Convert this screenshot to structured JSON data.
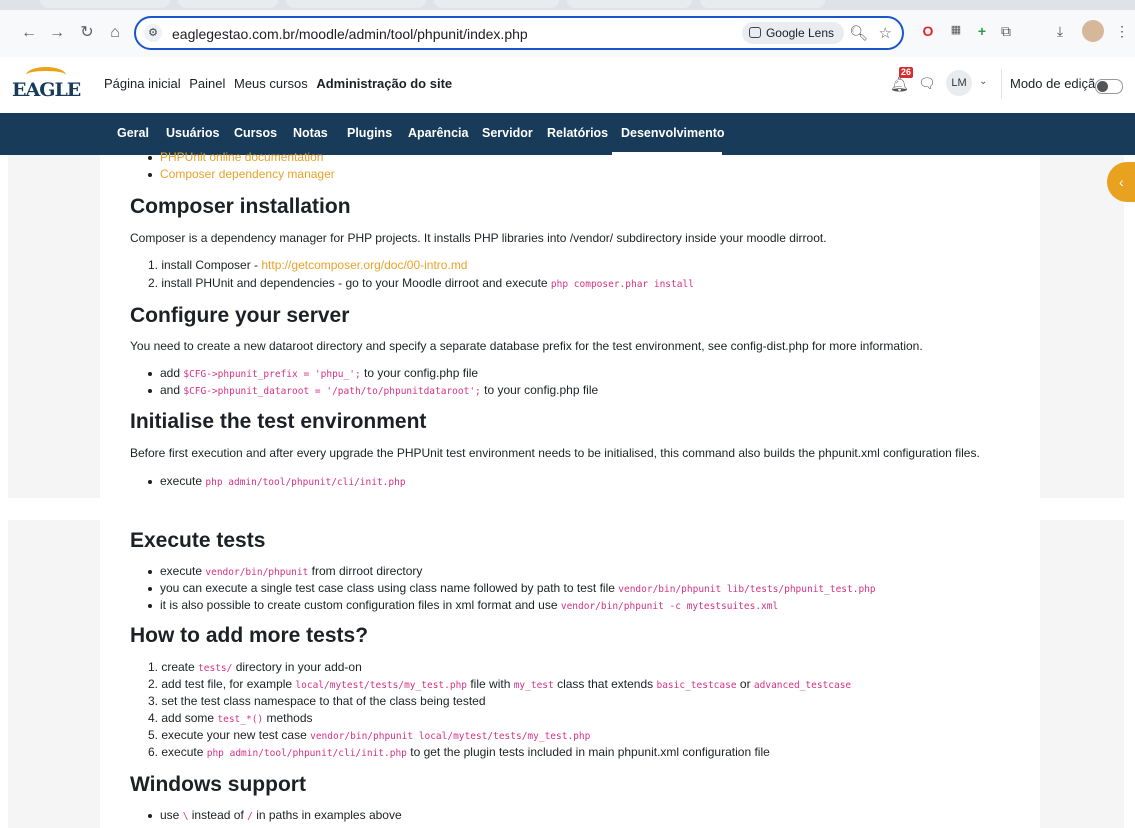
{
  "browser": {
    "url": "eaglegestao.com.br/moodle/admin/tool/phpunit/index.php",
    "lens_label": "Google Lens"
  },
  "header": {
    "logo_text": "EAGLE",
    "nav": [
      "Página inicial",
      "Painel",
      "Meus cursos",
      "Administração do site"
    ],
    "notification_count": "26",
    "avatar_initials": "LM",
    "edit_mode_label": "Modo de edição"
  },
  "secondary_nav": [
    "Geral",
    "Usuários",
    "Cursos",
    "Notas",
    "Plugins",
    "Aparência",
    "Servidor",
    "Relatórios",
    "Desenvolvimento"
  ],
  "content": {
    "top_links": [
      "PHPUnit online documentation",
      "Composer dependency manager"
    ],
    "composer": {
      "heading": "Composer installation",
      "intro": "Composer is a dependency manager for PHP projects. It installs PHP libraries into /vendor/ subdirectory inside your moodle dirroot.",
      "step1_prefix": "1. install Composer - ",
      "step1_link": "http://getcomposer.org/doc/00-intro.md",
      "step2_prefix": "2. install PHUnit and dependencies - go to your Moodle dirroot and execute ",
      "step2_code": "php composer.phar install"
    },
    "server": {
      "heading": "Configure your server",
      "intro": "You need to create a new dataroot directory and specify a separate database prefix for the test environment, see config-dist.php for more information.",
      "b1_prefix": "add ",
      "b1_code": "$CFG->phpunit_prefix = 'phpu_';",
      "b1_suffix": " to your config.php file",
      "b2_prefix": "and ",
      "b2_code": "$CFG->phpunit_dataroot = '/path/to/phpunitdataroot';",
      "b2_suffix": " to your config.php file"
    },
    "init": {
      "heading": "Initialise the test environment",
      "intro": "Before first execution and after every upgrade the PHPUnit test environment needs to be initialised, this command also builds the phpunit.xml configuration files.",
      "b1_prefix": "execute ",
      "b1_code": "php admin/tool/phpunit/cli/init.php"
    },
    "execute": {
      "heading": "Execute tests",
      "b1_prefix": "execute ",
      "b1_code": "vendor/bin/phpunit",
      "b1_suffix": " from dirroot directory",
      "b2_prefix": "you can execute a single test case class using class name followed by path to test file ",
      "b2_code": "vendor/bin/phpunit lib/tests/phpunit_test.php",
      "b3_prefix": "it is also possible to create custom configuration files in xml format and use ",
      "b3_code": "vendor/bin/phpunit -c mytestsuites.xml"
    },
    "howto": {
      "heading": "How to add more tests?",
      "s1_prefix": "1. create ",
      "s1_code": "tests/",
      "s1_suffix": " directory in your add-on",
      "s2_prefix": "2. add test file, for example ",
      "s2_code": "local/mytest/tests/my_test.php",
      "s2_mid": " file with ",
      "s2_code2": "my_test",
      "s2_mid2": " class that extends ",
      "s2_code3": "basic_testcase",
      "s2_mid3": " or ",
      "s2_code4": "advanced_testcase",
      "s3": "3. set the test class namespace to that of the class being tested",
      "s4_prefix": "4. add some ",
      "s4_code": "test_*()",
      "s4_suffix": " methods",
      "s5_prefix": "5. execute your new test case ",
      "s5_code": "vendor/bin/phpunit local/mytest/tests/my_test.php",
      "s6_prefix": "6. execute ",
      "s6_code": "php admin/tool/phpunit/cli/init.php",
      "s6_suffix": " to get the plugin tests included in main phpunit.xml configuration file"
    },
    "windows": {
      "heading": "Windows support",
      "b1_prefix": "use ",
      "b1_code": "\\",
      "b1_mid": " instead of ",
      "b1_code2": "/",
      "b1_suffix": " in paths in examples above"
    }
  },
  "colors": {
    "nav_bg": "#173b59",
    "link": "#e8a32a",
    "code": "#d63384",
    "accent": "#e8a21f"
  }
}
